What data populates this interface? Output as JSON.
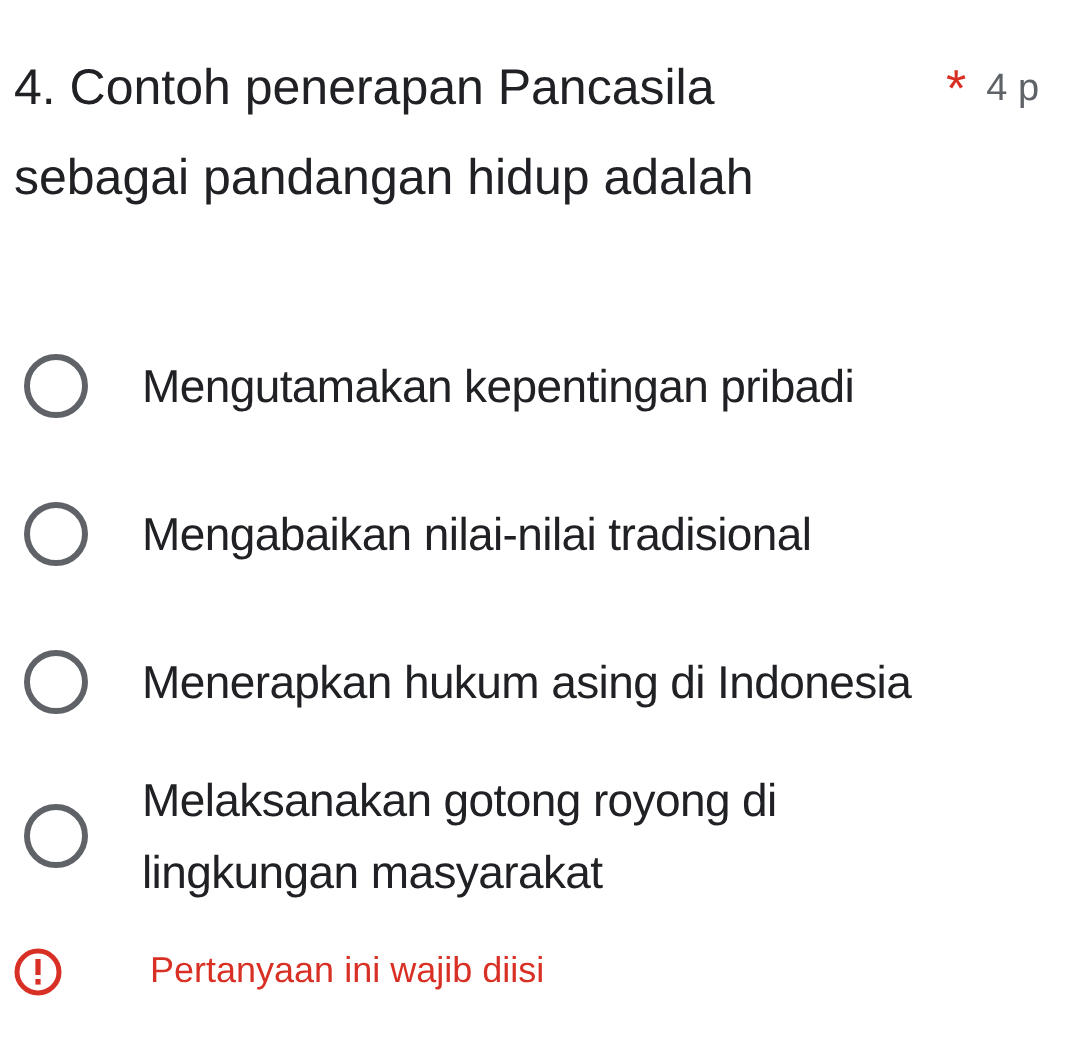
{
  "question": {
    "title": "4. Contoh penerapan Pancasila sebagai pandangan hidup adalah",
    "required": true,
    "required_mark": "*",
    "points": "4 p"
  },
  "options": [
    {
      "label": "Mengutamakan kepentingan pribadi",
      "selected": false
    },
    {
      "label": "Mengabaikan nilai-nilai tradisional",
      "selected": false
    },
    {
      "label": "Menerapkan hukum asing di Indonesia",
      "selected": false
    },
    {
      "label": "Melaksanakan gotong royong di lingkungan masyarakat",
      "selected": false
    }
  ],
  "error": {
    "message": "Pertanyaan ini wajib diisi"
  }
}
